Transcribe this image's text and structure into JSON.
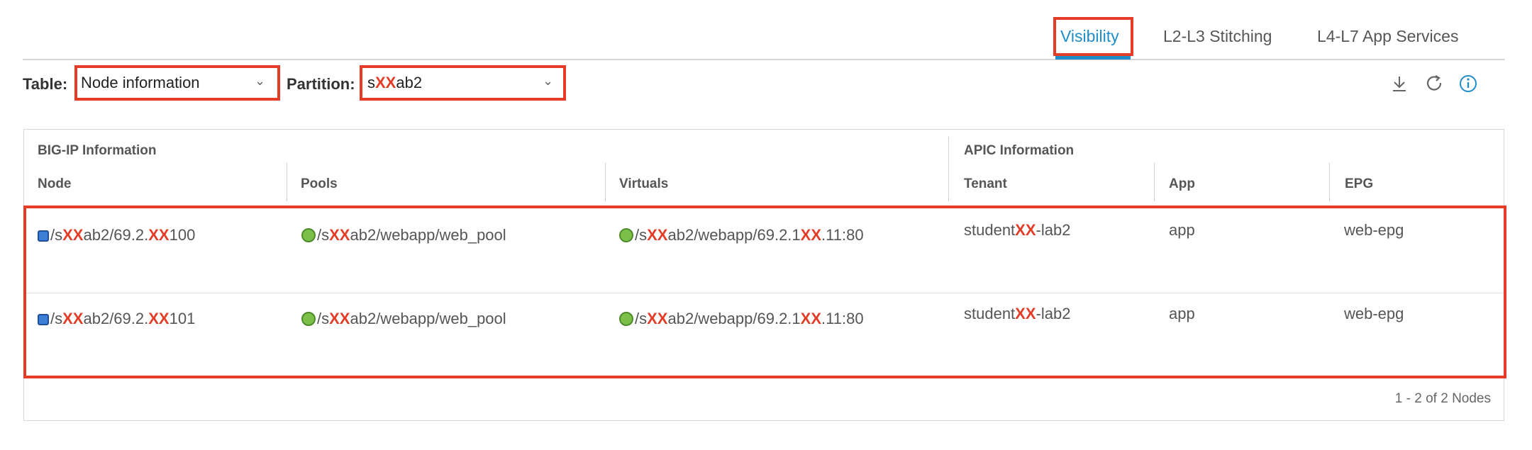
{
  "tabs": [
    {
      "label": "Visibility",
      "active": true
    },
    {
      "label": "L2-L3 Stitching",
      "active": false
    },
    {
      "label": "L4-L7 App Services",
      "active": false
    }
  ],
  "filters": {
    "table_label": "Table:",
    "table_value": "Node information",
    "partition_label": "Partition:",
    "partition_prefix": "s",
    "partition_mask": "XX",
    "partition_suffix": "ab2"
  },
  "toolbar_icons": [
    "download-icon",
    "refresh-icon",
    "info-icon"
  ],
  "grid": {
    "group_bigip": "BIG-IP Information",
    "group_apic": "APIC Information",
    "columns": [
      "Node",
      "Pools",
      "Virtuals",
      "Tenant",
      "App",
      "EPG"
    ],
    "mask": "XX",
    "rows": [
      {
        "node_a": "/s",
        "node_b": "ab2/69.2.",
        "node_c": "100",
        "pool_a": "/s",
        "pool_b": "ab2/webapp/web_pool",
        "virt_a": "/s",
        "virt_b": "ab2/webapp/69.2.1",
        "virt_c": ".11:80",
        "tenant_a": "student",
        "tenant_b": "-lab2",
        "app": "app",
        "epg": "web-epg"
      },
      {
        "node_a": "/s",
        "node_b": "ab2/69.2.",
        "node_c": "101",
        "pool_a": "/s",
        "pool_b": "ab2/webapp/web_pool",
        "virt_a": "/s",
        "virt_b": "ab2/webapp/69.2.1",
        "virt_c": ".11:80",
        "tenant_a": "student",
        "tenant_b": "-lab2",
        "app": "app",
        "epg": "web-epg"
      }
    ],
    "footer": "1 - 2 of 2 Nodes"
  },
  "colors": {
    "accent": "#1f8dc9",
    "highlight": "#e53c27"
  }
}
